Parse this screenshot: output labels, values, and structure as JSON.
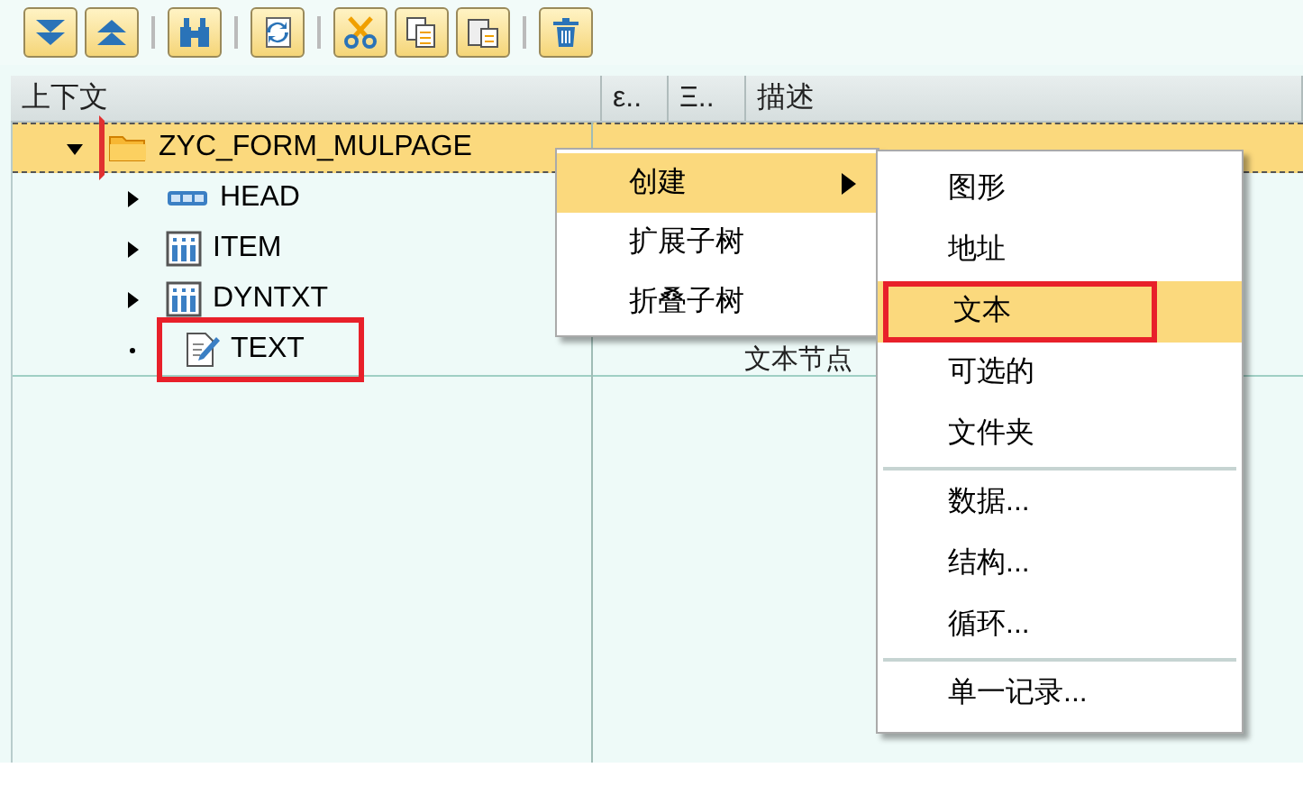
{
  "toolbar": [
    {
      "kind": "expand-all"
    },
    {
      "kind": "collapse-all"
    },
    {
      "kind": "separator"
    },
    {
      "kind": "find"
    },
    {
      "kind": "separator"
    },
    {
      "kind": "refresh"
    },
    {
      "kind": "separator"
    },
    {
      "kind": "cut"
    },
    {
      "kind": "copy"
    },
    {
      "kind": "paste"
    },
    {
      "kind": "separator"
    },
    {
      "kind": "delete"
    }
  ],
  "columns": [
    "上下文",
    "ε..",
    "Ξ..",
    "描述"
  ],
  "tree": [
    {
      "label": "ZYC_FORM_MULPAGE",
      "kind": "folder",
      "expanded": true,
      "selected": true,
      "outlined": false,
      "children": [
        {
          "label": "HEAD",
          "kind": "structure",
          "expanded": false,
          "selected": false,
          "outlined": false
        },
        {
          "label": "ITEM",
          "kind": "table",
          "expanded": false,
          "selected": false,
          "outlined": false
        },
        {
          "label": "DYNTXT",
          "kind": "table",
          "expanded": false,
          "selected": false,
          "outlined": false
        },
        {
          "label": "TEXT",
          "kind": "text",
          "leaf": true,
          "selected": false,
          "outlined": true,
          "description": "文本节点"
        }
      ]
    }
  ],
  "context_menu": [
    {
      "label": "创建",
      "selected": true,
      "submenu": true
    },
    {
      "label": "扩展子树",
      "selected": false
    },
    {
      "label": "折叠子树",
      "selected": false
    }
  ],
  "submenu": [
    {
      "label": "图形",
      "selected": false,
      "outlined": false
    },
    {
      "label": "地址",
      "selected": false,
      "outlined": false
    },
    {
      "label": "文本",
      "selected": true,
      "outlined": true
    },
    {
      "label": "可选的",
      "selected": false,
      "outlined": false
    },
    {
      "label": "文件夹",
      "selected": false,
      "outlined": false
    },
    {
      "kind": "separator"
    },
    {
      "label": "数据...",
      "selected": false,
      "outlined": false
    },
    {
      "label": "结构...",
      "selected": false,
      "outlined": false
    },
    {
      "label": "循环...",
      "selected": false,
      "outlined": false
    },
    {
      "kind": "separator"
    },
    {
      "label": "单一记录...",
      "selected": false,
      "outlined": false
    }
  ]
}
